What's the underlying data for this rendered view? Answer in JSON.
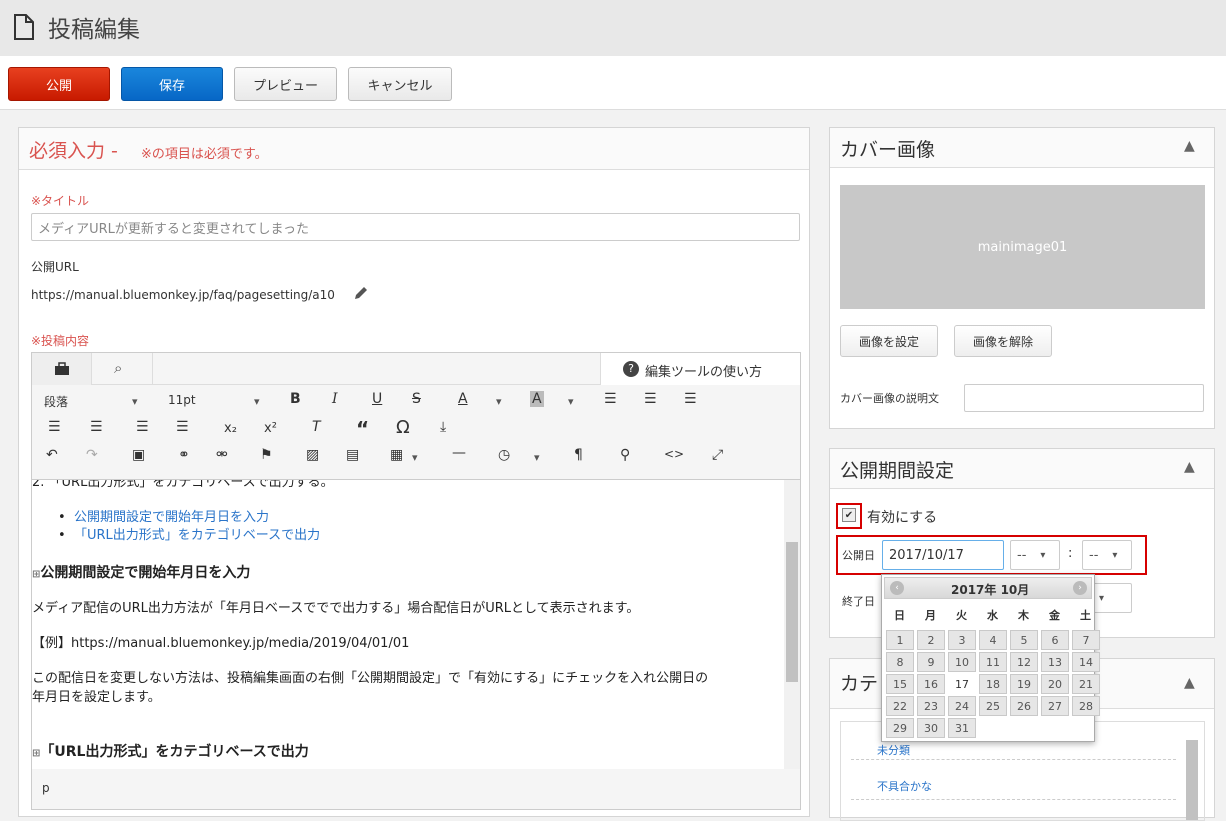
{
  "header": {
    "title": "投稿編集"
  },
  "toolbar": {
    "publish": "公開",
    "save": "保存",
    "preview": "プレビュー",
    "cancel": "キャンセル"
  },
  "required": {
    "heading": "必須入力 -",
    "note": "※の項目は必須です。",
    "title_label": "※タイトル",
    "title_placeholder": "メディアURLが更新すると変更されてしまった",
    "url_label": "公開URL",
    "url_value": "https://manual.bluemonkey.jp/faq/pagesetting/a10",
    "content_label": "※投稿内容"
  },
  "editor": {
    "help": "編集ツールの使い方",
    "format": "段落",
    "fontsize": "11pt",
    "lines": {
      "l0": "2. 「URL出力形式」をカテゴリベースで出力する。",
      "b1": "公開期間設定で開始年月日を入力",
      "b2": "「URL出力形式」をカテゴリベースで出力",
      "h1": "公開期間設定で開始年月日を入力",
      "p1": "メディア配信のURL出力方法が「年月日ベースででで出力する」場合配信日がURLとして表示されます。",
      "p2": "【例】https://manual.bluemonkey.jp/media/2019/04/01/01",
      "p3": "この配信日を変更しない方法は、投稿編集画面の右側「公開期間設定」で「有効にする」にチェックを入れ公開日の",
      "p4": "年月日を設定します。",
      "h2": "「URL出力形式」をカテゴリベースで出力"
    },
    "status": "p"
  },
  "cover": {
    "title": "カバー画像",
    "image_text": "mainimage01",
    "set": "画像を設定",
    "unset": "画像を解除",
    "desc_label": "カバー画像の説明文"
  },
  "period": {
    "title": "公開期間設定",
    "enable": "有効にする",
    "start_label": "公開日",
    "start_value": "2017/10/17",
    "hour": "--",
    "minute": "--",
    "colon": ":",
    "end_label": "終了日"
  },
  "calendar": {
    "month": "2017年 10月",
    "weekdays": [
      "日",
      "月",
      "火",
      "水",
      "木",
      "金",
      "土"
    ],
    "days": [
      "1",
      "2",
      "3",
      "4",
      "5",
      "6",
      "7",
      "8",
      "9",
      "10",
      "11",
      "12",
      "13",
      "14",
      "15",
      "16",
      "17",
      "18",
      "19",
      "20",
      "21",
      "22",
      "23",
      "24",
      "25",
      "26",
      "27",
      "28",
      "29",
      "30",
      "31"
    ],
    "today": "17"
  },
  "category": {
    "title": "カテ",
    "items": [
      "未分類",
      "不具合かな"
    ]
  },
  "colors": {
    "accent_red": "#d32f2f",
    "link": "#2a74c9"
  }
}
